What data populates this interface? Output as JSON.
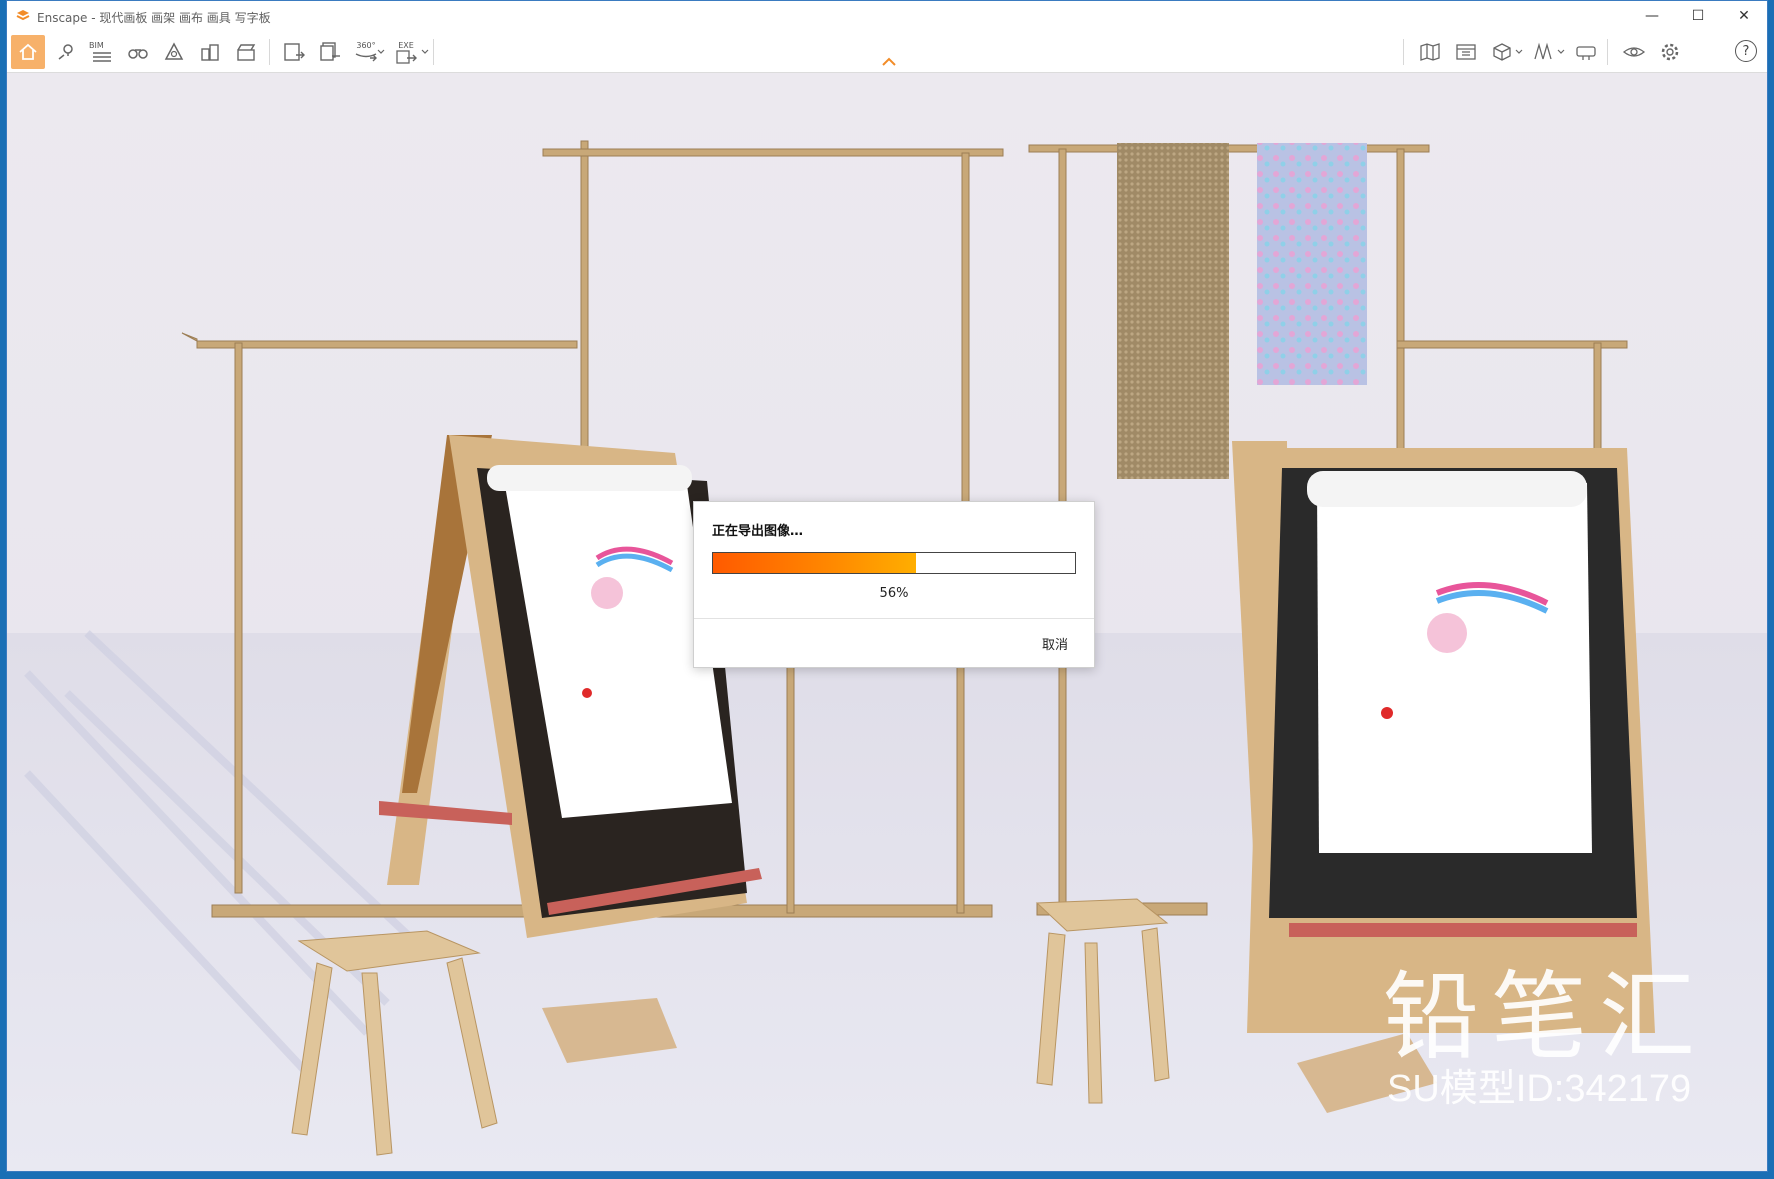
{
  "window": {
    "title": "Enscape - 现代画板 画架 画布 画具 写字板",
    "controls": {
      "minimize": "—",
      "maximize": "☐",
      "close": "✕"
    }
  },
  "toolbar": {
    "left_icons": [
      "home-icon",
      "location-pin-icon",
      "bim-icon",
      "binoculars-icon",
      "atmosphere-icon",
      "buildings-icon",
      "clapperboard-icon",
      "export-screenshot-icon",
      "batch-render-icon",
      "panorama-360-icon",
      "exe-export-icon"
    ],
    "bim_label": "BIM",
    "panorama_label": "360°",
    "exe_label": "EXE",
    "right_icons": [
      "map-icon",
      "asset-library-icon",
      "cube-view-icon",
      "material-editor-icon",
      "vr-headset-icon",
      "visual-settings-eye-icon",
      "settings-gear-icon"
    ],
    "help_label": "?"
  },
  "dialog": {
    "title": "正在导出图像…",
    "progress_percent": 56,
    "progress_label": "56%",
    "cancel_label": "取消"
  },
  "watermark": {
    "brand": "铅笔汇",
    "model_id": "SU模型ID:342179"
  },
  "colors": {
    "accent": "#f28c28",
    "progress_start": "#ff5a00",
    "progress_end": "#ffae00",
    "desktop": "#1a6fb5"
  }
}
